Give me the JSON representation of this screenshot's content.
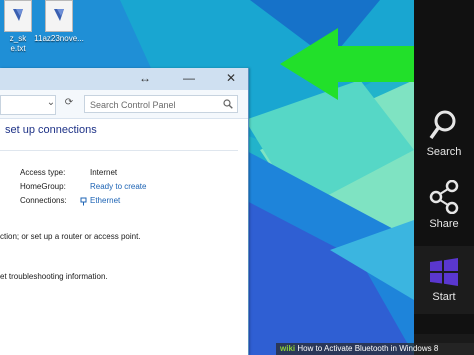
{
  "desktop": {
    "icons": [
      {
        "label_line1": "z_sk",
        "label_line2": "e.txt",
        "icon": "text-file-icon"
      },
      {
        "label_line1": "11az23nove...",
        "label_line2": "",
        "icon": "text-file-icon"
      }
    ]
  },
  "window": {
    "title_buttons": {
      "restore": "↔",
      "minimize": "—",
      "close": "✕"
    },
    "nav": {
      "dropdown": "⌄",
      "refresh": "⟳"
    },
    "search": {
      "placeholder": "Search Control Panel",
      "icon": "search-icon"
    },
    "heading": "set up connections",
    "network": {
      "access_type_label": "Access type:",
      "access_type_value": "Internet",
      "homegroup_label": "HomeGroup:",
      "homegroup_value": "Ready to create",
      "connections_label": "Connections:",
      "connections_value": "Ethernet"
    },
    "text_1": "ction; or set up a router or access point.",
    "text_2": "et troubleshooting information."
  },
  "charms": [
    {
      "label": "Search",
      "icon": "search-icon"
    },
    {
      "label": "Share",
      "icon": "share-icon"
    },
    {
      "label": "Start",
      "icon": "windows-logo-icon"
    }
  ],
  "annotation": {
    "arrow": "green-arrow",
    "color": "#22e02a"
  },
  "watermark": {
    "brand": "wiki",
    "text": "How to Activate Bluetooth in Windows 8"
  },
  "colors": {
    "wallpaper": "#1fb2c8",
    "charms_bg": "#111111",
    "start_tile": "#4f2bb8",
    "link": "#1c63b4"
  }
}
